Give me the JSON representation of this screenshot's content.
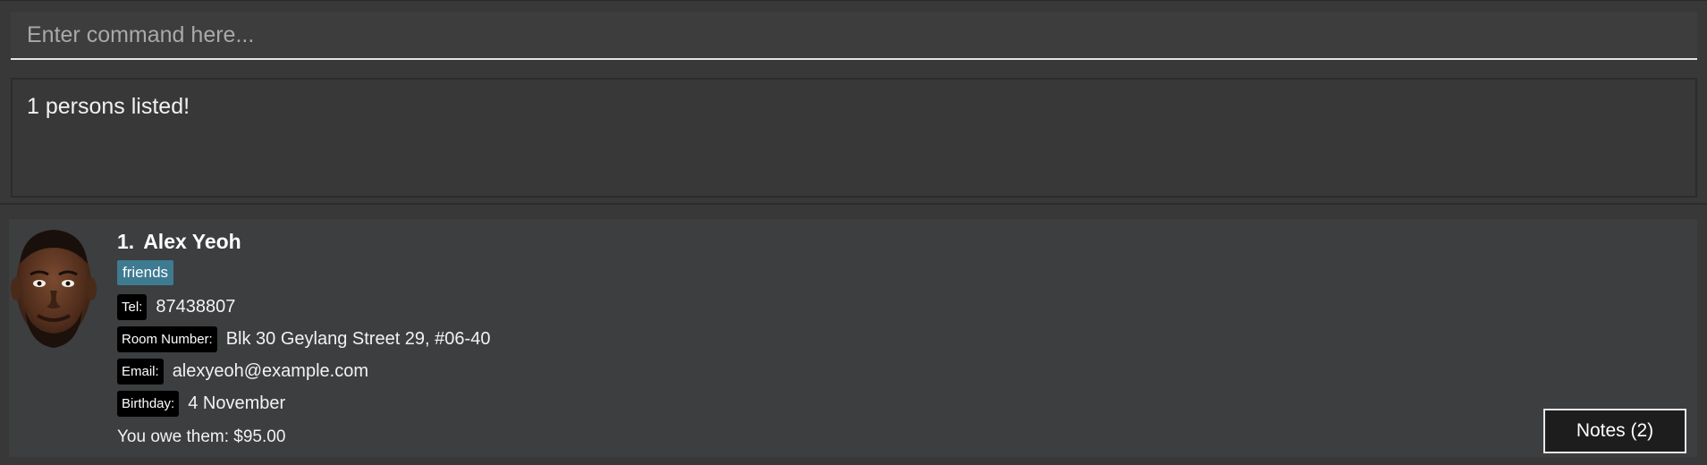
{
  "command": {
    "placeholder": "Enter command here...",
    "value": ""
  },
  "result": {
    "message": "1 persons listed!"
  },
  "persons": [
    {
      "index": "1.",
      "name": "Alex Yeoh",
      "tags": [
        "friends"
      ],
      "fields": {
        "tel_label": "Tel:",
        "tel": "87438807",
        "room_label": "Room Number:",
        "room": "Blk 30 Geylang Street 29, #06-40",
        "email_label": "Email:",
        "email": "alexyeoh@example.com",
        "birthday_label": "Birthday:",
        "birthday": "4 November"
      },
      "owe": "You owe them: $95.00",
      "notes_button": "Notes (2)",
      "avatar_icon": "person-avatar-photo"
    }
  ],
  "colors": {
    "background": "#383838",
    "card": "#3c3e3f",
    "tag": "#3e7b91",
    "field_label": "#000000",
    "notes_button": "#1d1d1d"
  }
}
